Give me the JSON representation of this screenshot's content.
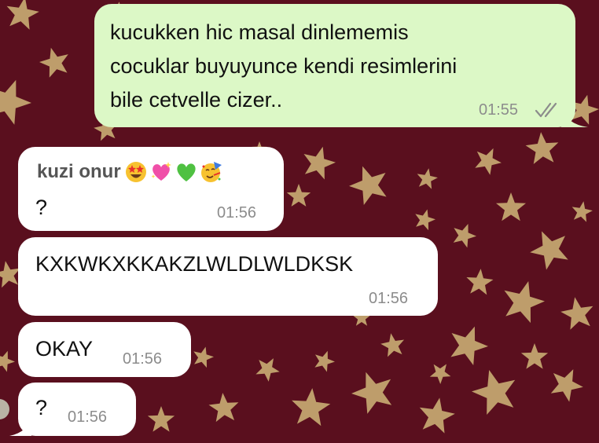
{
  "colors": {
    "background": "#5a0f1e",
    "star": "#c9ad73",
    "outgoing_bubble": "#dcf8c6",
    "incoming_bubble": "#ffffff",
    "timestamp": "#8c8c8c",
    "read_ticks": "#8c8c8c"
  },
  "messages": [
    {
      "direction": "outgoing",
      "lines": [
        "kucukken hic masal dinlememis",
        "cocuklar buyuyunce kendi resimlerini",
        "bile cetvelle cizer.."
      ],
      "time": "01:55",
      "status_icon": "double-check-icon"
    },
    {
      "direction": "incoming",
      "sender": "kuzi onur",
      "sender_emojis": [
        "star-struck-emoji",
        "sparkling-heart-emoji",
        "green-heart-emoji",
        "partying-face-emoji"
      ],
      "text": "?",
      "time": "01:56"
    },
    {
      "direction": "incoming",
      "text": "KXKWKXKKAKZLWLDLWLDKSK",
      "time": "01:56"
    },
    {
      "direction": "incoming",
      "text": "OKAY",
      "time": "01:56"
    },
    {
      "direction": "incoming",
      "text": "?",
      "time": "01:56"
    }
  ]
}
